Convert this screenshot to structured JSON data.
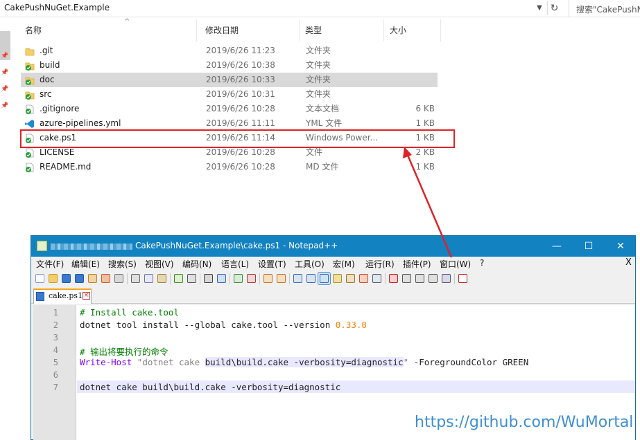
{
  "explorer": {
    "address": "CakePushNuGet.Example",
    "search_placeholder": "搜索\"CakePushNuG",
    "columns": {
      "name": "名称",
      "date": "修改日期",
      "type": "类型",
      "size": "大小"
    },
    "files": [
      {
        "name": ".git",
        "date": "2019/6/26 11:23",
        "type": "文件夹",
        "size": "",
        "icon": "folder-icon"
      },
      {
        "name": "build",
        "date": "2019/6/26 10:38",
        "type": "文件夹",
        "size": "",
        "icon": "folder-synced-icon"
      },
      {
        "name": "doc",
        "date": "2019/6/26 10:33",
        "type": "文件夹",
        "size": "",
        "icon": "folder-synced-icon"
      },
      {
        "name": "src",
        "date": "2019/6/26 10:31",
        "type": "文件夹",
        "size": "",
        "icon": "folder-synced-icon"
      },
      {
        "name": ".gitignore",
        "date": "2019/6/26 10:28",
        "type": "文本文档",
        "size": "6 KB",
        "icon": "text-file-synced-icon"
      },
      {
        "name": "azure-pipelines.yml",
        "date": "2019/6/26 11:11",
        "type": "YML 文件",
        "size": "1 KB",
        "icon": "vscode-file-icon"
      },
      {
        "name": "cake.ps1",
        "date": "2019/6/26 11:14",
        "type": "Windows Power...",
        "size": "1 KB",
        "icon": "ps1-file-synced-icon"
      },
      {
        "name": "LICENSE",
        "date": "2019/6/26 10:28",
        "type": "文件",
        "size": "2 KB",
        "icon": "file-synced-icon"
      },
      {
        "name": "README.md",
        "date": "2019/6/26 10:28",
        "type": "MD 文件",
        "size": "1 KB",
        "icon": "md-file-synced-icon"
      }
    ]
  },
  "notepad": {
    "title": "CakePushNuGet.Example\\cake.ps1 - Notepad++",
    "menu": [
      "文件(F)",
      "编辑(E)",
      "搜索(S)",
      "视图(V)",
      "编码(N)",
      "语言(L)",
      "设置(T)",
      "工具(O)",
      "宏(M)",
      "运行(R)",
      "插件(P)",
      "窗口(W)",
      "?"
    ],
    "menu_close": "X",
    "tab_label": "cake.ps1",
    "lines": [
      "1",
      "2",
      "3",
      "4",
      "5",
      "6",
      "7"
    ],
    "code": {
      "l1": "# Install cake.tool",
      "l2_a": "dotnet tool install --global cake.tool --version ",
      "l2_b": "0.33.0",
      "l4": "# 输出将要执行的命令",
      "l5_a": "Write-Host",
      "l5_b": " \"dotnet cake ",
      "l5_c": "build\\build.cake -verbosity=diagnostic",
      "l5_d": "\" ",
      "l5_e": "-ForegroundColor GREEN",
      "l7": "dotnet cake build\\build.cake -verbosity=diagnostic"
    }
  },
  "watermark": "https://github.com/WuMortal",
  "colors": {
    "highlight_box": "#e02127",
    "title_bar": "#1282c1",
    "watermark": "#3d8fd1"
  }
}
